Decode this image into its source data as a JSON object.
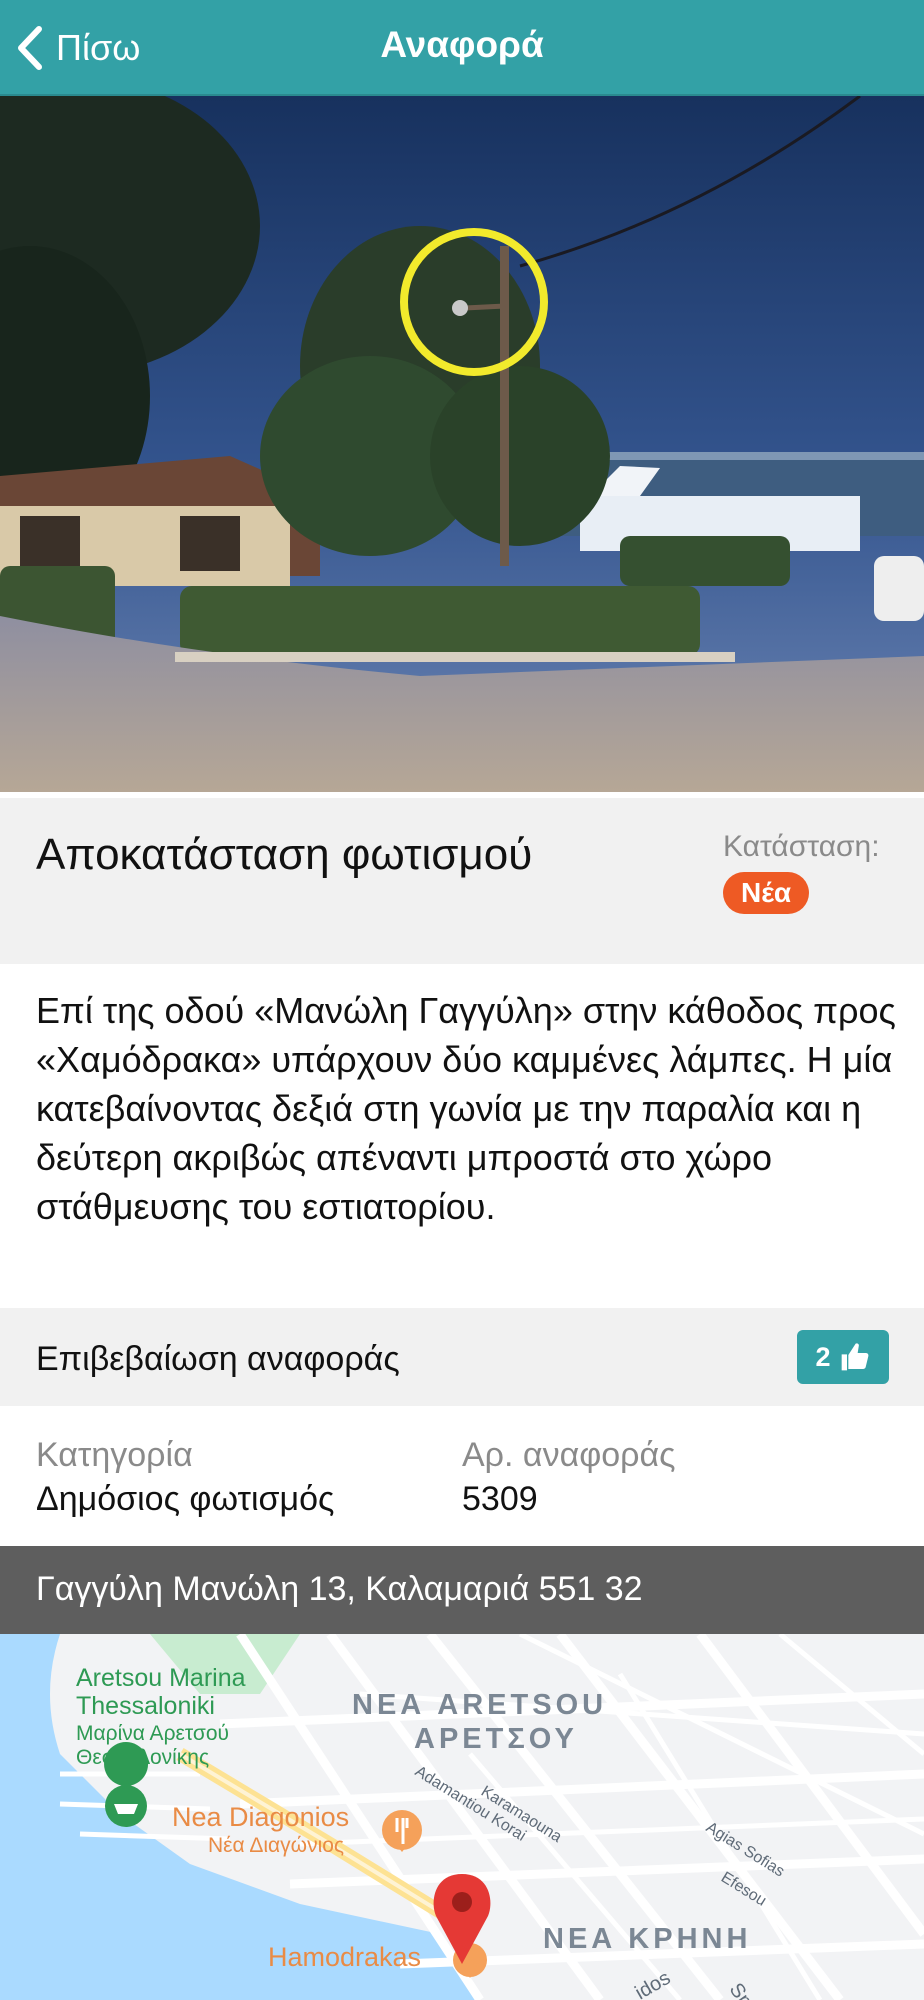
{
  "header": {
    "back_label": "Πίσω",
    "title": "Αναφορά"
  },
  "report": {
    "title": "Αποκατάσταση φωτισμού",
    "status_label": "Κατάσταση:",
    "status_value": "Νέα",
    "description": "Επί της οδού «Μανώλη Γαγγύλη» στην κάθοδος προς «Χαμόδρακα» υπάρχουν δύο καμμένες λάμπες. Η μία κατεβαίνοντας δεξιά στη γωνία με την παραλία και η δεύτερη ακριβώς απέναντι μπροστά στο χώρο στάθμευσης του εστιατορίου."
  },
  "confirm": {
    "label": "Επιβεβαίωση αναφοράς",
    "count": "2"
  },
  "meta": {
    "category_label": "Κατηγορία",
    "category_value": "Δημόσιος φωτισμός",
    "number_label": "Αρ. αναφοράς",
    "number_value": "5309"
  },
  "address": "Γαγγύλη Μανώλη 13, Καλαμαριά 551 32",
  "map": {
    "labels": {
      "marina_en": "Aretsou Marina",
      "marina_en2": "Thessaloniki",
      "marina_gr": "Μαρίνα Αρετσού",
      "marina_gr2": "Θεσσαλονίκης",
      "area1_en": "ΝΕΑ ARETSOU",
      "area1_gr": "ΑΡΕΤΣΟΥ",
      "street1": "Adamantiou Korai",
      "street2": "Karamaouna",
      "street3": "Agias Sofias",
      "street4": "Efesou",
      "place2_en": "Nea Diagonios",
      "place2_gr": "Νέα Διαγώνιος",
      "place3": "Hamodrakas",
      "area2": "ΝΕΑ ΚΡΗΝΗ",
      "street5": "idos",
      "street6": "Smi"
    },
    "colors": {
      "water": "#aadaff",
      "land": "#f2f3f5",
      "road": "#ffffff",
      "park": "#c8ecd0",
      "pin": "#e53935",
      "poi": "#f5a15a",
      "marina_poi": "#2e9a54"
    }
  },
  "icons": {
    "back": "chevron-left-icon",
    "like": "thumbs-up-icon",
    "pin": "map-pin-icon"
  },
  "colors": {
    "header": "#33a1a6",
    "status_badge": "#ee5a24",
    "address_bar": "#5e5e5e"
  }
}
